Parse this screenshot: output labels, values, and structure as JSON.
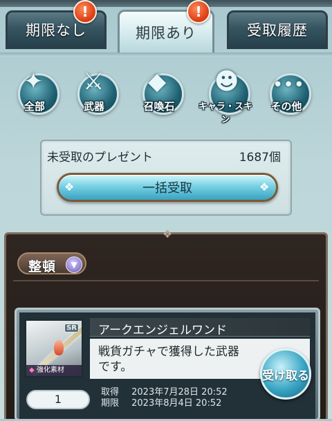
{
  "tabs": [
    {
      "label": "期限なし",
      "alert": "!"
    },
    {
      "label": "期限あり",
      "alert": "!"
    },
    {
      "label": "受取履歴"
    }
  ],
  "categories": [
    {
      "label": "全部",
      "icon": "all-items-icon"
    },
    {
      "label": "武器",
      "icon": "sword-icon"
    },
    {
      "label": "召喚石",
      "icon": "crystal-icon"
    },
    {
      "label": "キャラ・スキン",
      "icon": "character-silhouette-icon"
    },
    {
      "label": "その他",
      "icon": "ellipsis-icon"
    }
  ],
  "present": {
    "title": "未受取のプレゼント",
    "count": "1687個",
    "bulk_button": "一括受取"
  },
  "list": {
    "sort_label": "整頓"
  },
  "item": {
    "rarity": "SR",
    "tag": "強化素材",
    "name": "アークエンジェルワンド",
    "description": "戦貨ガチャで獲得した武器です。",
    "receive_button": "受け取る",
    "quantity": "1",
    "acquired_label": "取得",
    "acquired_date": "2023年7月28日 20:52",
    "expiry_label": "期限",
    "expiry_date": "2023年8月4日 20:52"
  },
  "colors": {
    "background": "#bcd6d9",
    "alert": "#d93a12",
    "button_accent": "#39a5c4",
    "list_background": "#2f2621"
  }
}
